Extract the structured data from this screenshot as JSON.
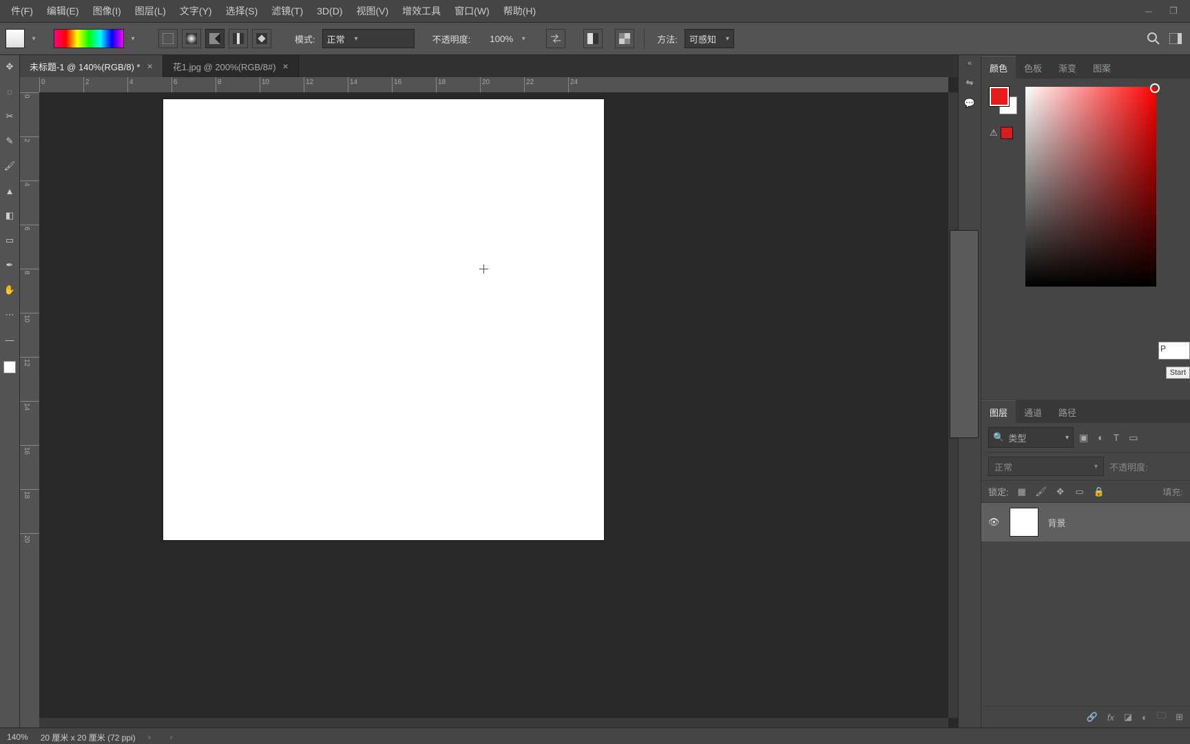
{
  "menu": {
    "items": [
      "件(F)",
      "编辑(E)",
      "图像(I)",
      "图层(L)",
      "文字(Y)",
      "选择(S)",
      "滤镜(T)",
      "3D(D)",
      "视图(V)",
      "增效工具",
      "窗口(W)",
      "帮助(H)"
    ]
  },
  "options": {
    "mode_label": "模式:",
    "mode_value": "正常",
    "opacity_label": "不透明度:",
    "opacity_value": "100%",
    "method_label": "方法:",
    "method_value": "可感知"
  },
  "tabs": [
    {
      "label": "未标题-1 @ 140%(RGB/8) *",
      "active": true
    },
    {
      "label": "花1.jpg @ 200%(RGB/8#)",
      "active": false
    }
  ],
  "ruler_h": [
    "0",
    "2",
    "4",
    "6",
    "8",
    "10",
    "12",
    "14",
    "16",
    "18",
    "20",
    "22",
    "24"
  ],
  "ruler_v": [
    "0",
    "2",
    "4",
    "6",
    "8",
    "10",
    "12",
    "14",
    "16",
    "18",
    "20"
  ],
  "color_panel": {
    "tabs": [
      "颜色",
      "色板",
      "渐变",
      "图案"
    ],
    "foreground": "#e61a1a",
    "warn_color": "#d91c1c",
    "hex_prefix": "P",
    "start_label": "Start"
  },
  "layers_panel": {
    "tabs": [
      "图层",
      "通道",
      "路径"
    ],
    "filter_label": "类型",
    "blend_value": "正常",
    "opacity_label": "不透明度:",
    "lock_label": "锁定:",
    "fill_label": "填充:",
    "items": [
      {
        "name": "背景",
        "visible": true
      }
    ]
  },
  "status": {
    "zoom": "140%",
    "doc_info": "20 厘米 x 20 厘米 (72 ppi)"
  }
}
